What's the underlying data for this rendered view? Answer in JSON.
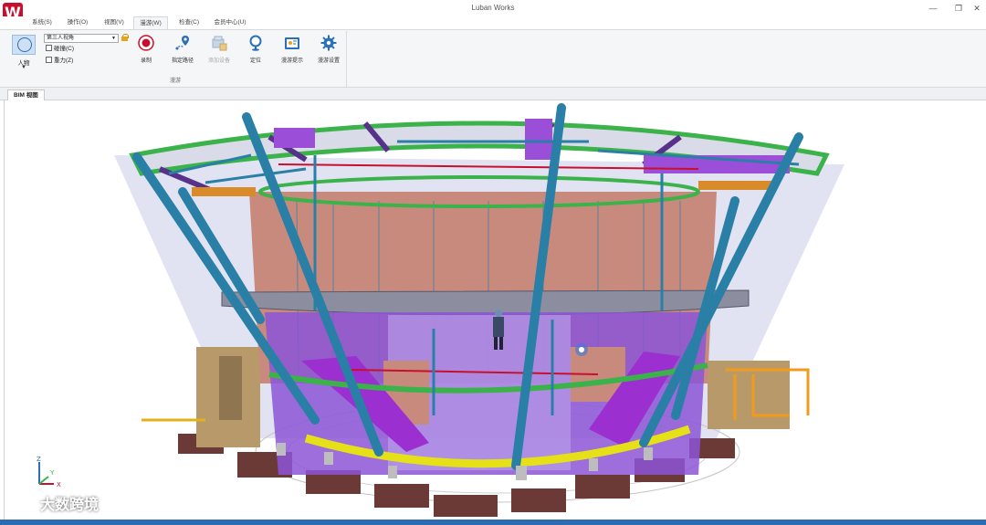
{
  "window": {
    "title": "Luban Works",
    "controls": [
      "—",
      "❐",
      "✕"
    ]
  },
  "menu": {
    "tabs": [
      {
        "label": "系统(S)",
        "active": false
      },
      {
        "label": "操作(O)",
        "active": false
      },
      {
        "label": "视图(V)",
        "active": false
      },
      {
        "label": "漫游(W)",
        "active": true
      },
      {
        "label": "检查(C)",
        "active": false
      },
      {
        "label": "会员中心(U)",
        "active": false
      }
    ]
  },
  "ribbon": {
    "person_label": "人物",
    "view_select_value": "第三人视角",
    "checkbox_wall": "碰撞(C)",
    "checkbox_gravity": "重力(Z)",
    "tools": [
      {
        "label": "录制",
        "icon": "record-icon",
        "disabled": false
      },
      {
        "label": "指定路径",
        "icon": "path-icon",
        "disabled": false
      },
      {
        "label": "添加设备",
        "icon": "add-device-icon",
        "disabled": true
      },
      {
        "label": "定位",
        "icon": "locate-icon",
        "disabled": false
      },
      {
        "label": "漫游提示",
        "icon": "roam-tip-icon",
        "disabled": false
      },
      {
        "label": "漫游设置",
        "icon": "roam-settings-icon",
        "disabled": false
      }
    ],
    "group_label": "漫游"
  },
  "document": {
    "tab_label": "BIM 视图"
  },
  "viewport": {
    "axis": {
      "z": "Z",
      "y": "Y",
      "x": "X"
    }
  },
  "watermark": {
    "text": "大数跨境"
  },
  "colors": {
    "accent": "#2b6cb0",
    "brand_red": "#c8102e",
    "column_blue": "#2a7fa6",
    "beam_green": "#3bb34a",
    "wall_salmon": "#c98a7e",
    "panel_purple": "#8c55d6",
    "ring_yellow": "#e6e018",
    "ground_brown": "#6b3a36"
  }
}
